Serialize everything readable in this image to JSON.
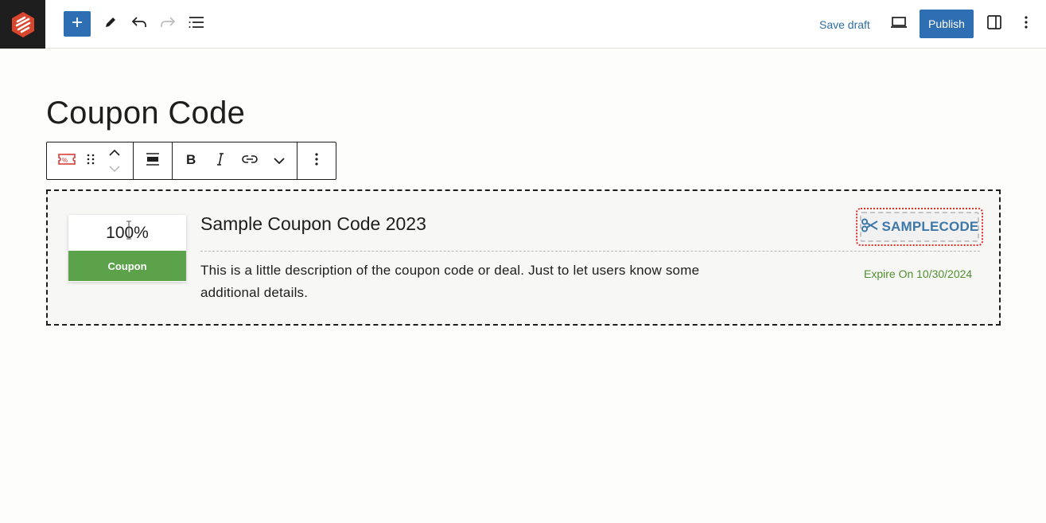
{
  "header": {
    "logo_icon": "editor-logo-icon",
    "add_block_icon": "plus-icon",
    "tools_icon": "pencil-icon",
    "undo_icon": "undo-icon",
    "redo_icon": "redo-icon",
    "list_view_icon": "list-view-icon",
    "save_draft_label": "Save draft",
    "preview_icon": "laptop-icon",
    "publish_label": "Publish",
    "settings_icon": "sidebar-panel-icon",
    "options_icon": "vertical-ellipsis-icon",
    "accent_color": "#2e6fb3"
  },
  "post": {
    "title": "Coupon Code"
  },
  "block_toolbar": {
    "block_type_icon": "coupon-block-icon",
    "drag_icon": "drag-handle-icon",
    "move_up_icon": "chevron-up-icon",
    "move_down_icon": "chevron-down-icon",
    "align_icon": "align-wide-icon",
    "bold_icon": "bold-icon",
    "italic_icon": "italic-icon",
    "link_icon": "link-icon",
    "more_formatting_icon": "chevron-down-icon",
    "block_options_icon": "vertical-ellipsis-icon"
  },
  "coupon": {
    "discount_value": "100%",
    "discount_label": "Coupon",
    "title": "Sample Coupon Code 2023",
    "description": "This is a little description of the coupon code or deal. Just to let users know some additional details.",
    "code_icon": "scissors-icon",
    "code": "SAMPLECODE",
    "expire_text": "Expire On 10/30/2024",
    "label_color": "#5ba24a",
    "code_color": "#3e78a8",
    "code_border_color": "#d9302a",
    "expire_color": "#4f8f2f"
  }
}
